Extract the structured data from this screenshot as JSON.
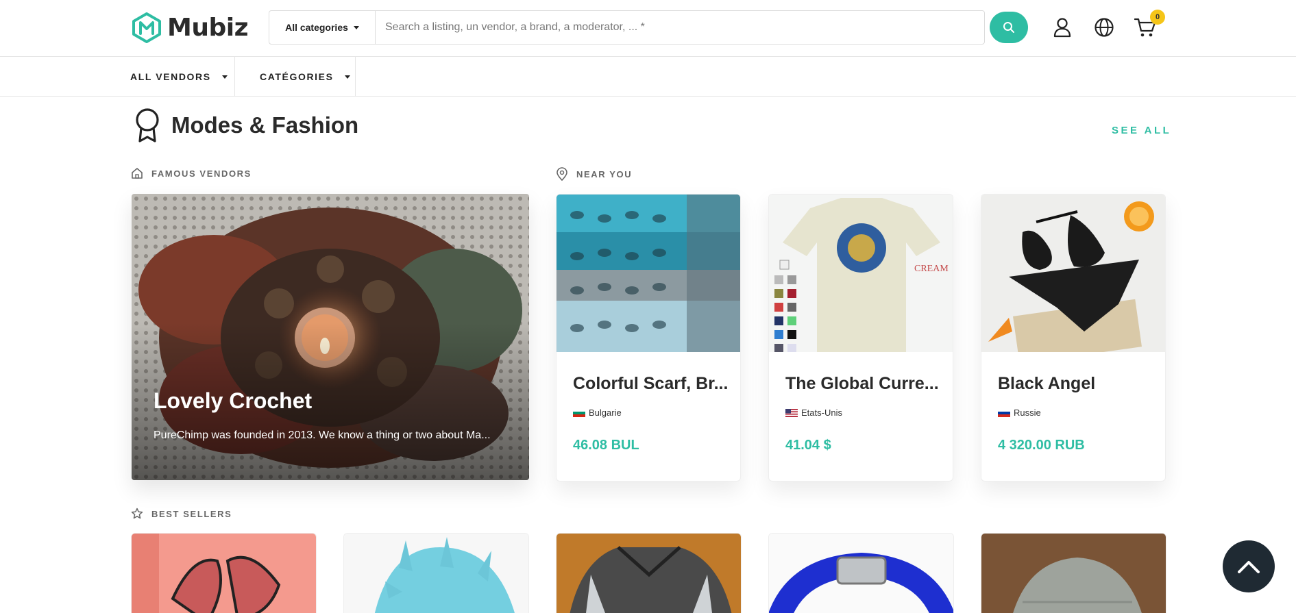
{
  "header": {
    "logo_text": "Mubiz",
    "category_select": "All categories",
    "search_placeholder": "Search a listing, un vendor, a brand, a moderator, ... *",
    "cart_count": "0",
    "icons": [
      "search-icon",
      "user-icon",
      "globe-icon",
      "cart-icon"
    ]
  },
  "nav": {
    "items": [
      {
        "label": "ALL VENDORS"
      },
      {
        "label": "CATÉGORIES"
      }
    ]
  },
  "section": {
    "title": "Modes & Fashion",
    "see_all": "SEE ALL",
    "famous_vendors_label": "FAMOUS VENDORS",
    "near_you_label": "NEAR YOU",
    "best_sellers_label": "BEST SELLERS"
  },
  "vendor": {
    "title": "Lovely Crochet",
    "description": "PureChimp was founded in 2013. We know a thing or two about Ma..."
  },
  "products": [
    {
      "name": "Colorful Scarf, Br...",
      "country": "Bulgarie",
      "price": "46.08 BUL"
    },
    {
      "name": "The Global Curre...",
      "country": "Etats-Unis",
      "price": "41.04 $"
    },
    {
      "name": "Black Angel",
      "country": "Russie",
      "price": "4 320.00 RUB"
    }
  ],
  "colors": {
    "accent": "#2ebda3",
    "badge": "#f5c518",
    "dark": "#1f2a33"
  }
}
